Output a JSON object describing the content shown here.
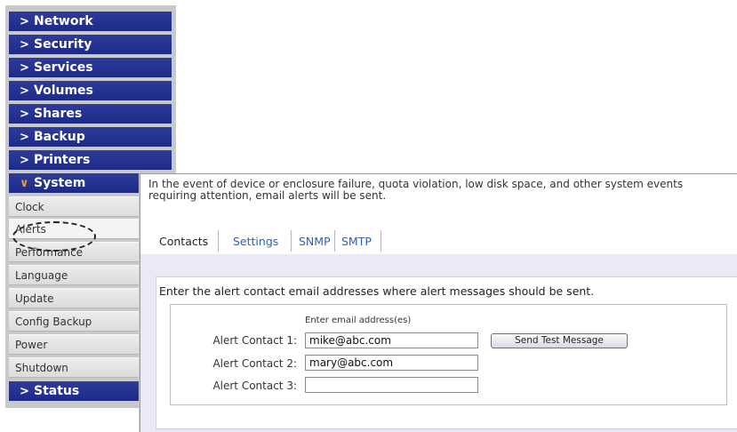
{
  "sidebar": {
    "top_items": [
      {
        "label": "Network",
        "icon": "chevron-right"
      },
      {
        "label": "Security",
        "icon": "chevron-right"
      },
      {
        "label": "Services",
        "icon": "chevron-right"
      },
      {
        "label": "Volumes",
        "icon": "chevron-right"
      },
      {
        "label": "Shares",
        "icon": "chevron-right"
      },
      {
        "label": "Backup",
        "icon": "chevron-right"
      },
      {
        "label": "Printers",
        "icon": "chevron-right"
      }
    ],
    "open_item": {
      "label": "System",
      "icon": "chevron-down"
    },
    "sub_items": [
      {
        "label": "Clock"
      },
      {
        "label": "Alerts"
      },
      {
        "label": "Performance"
      },
      {
        "label": "Language"
      },
      {
        "label": "Update"
      },
      {
        "label": "Config Backup"
      },
      {
        "label": "Power"
      },
      {
        "label": "Shutdown"
      }
    ],
    "bottom_item": {
      "label": "Status",
      "icon": "chevron-right"
    },
    "selected": "Alerts"
  },
  "main": {
    "intro": "In the event of device or enclosure failure, quota violation, low disk space, and other system events\nrequiring attention, email alerts will be sent.",
    "tabs": [
      {
        "label": "Contacts",
        "active": true
      },
      {
        "label": "Settings",
        "active": false
      },
      {
        "label": "SNMP",
        "active": false
      },
      {
        "label": "SMTP",
        "active": false
      }
    ],
    "instruction": "Enter the alert contact email addresses where alert messages should be sent.",
    "email_caption": "Enter email address(es)",
    "contacts": [
      {
        "label": "Alert Contact 1:",
        "value": "mike@abc.com"
      },
      {
        "label": "Alert Contact 2:",
        "value": "mary@abc.com"
      },
      {
        "label": "Alert Contact 3:",
        "value": ""
      }
    ],
    "send_test_label": "Send Test Message"
  },
  "colors": {
    "nav_blue": "#1e2a86",
    "link_blue": "#2a5fbf",
    "panel_lavender": "#eaeaf6"
  }
}
